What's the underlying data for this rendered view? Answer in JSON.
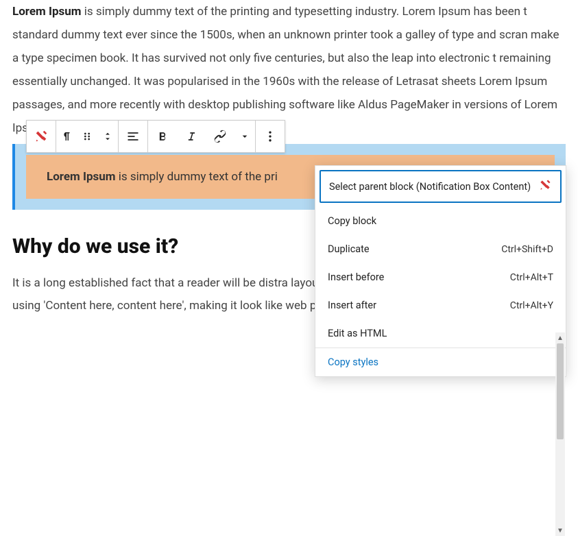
{
  "paragraph1": {
    "strong": "Lorem Ipsum",
    "text": " is simply dummy text of the printing and typesetting industry. Lorem Ipsum has been t standard dummy text ever since the 1500s, when an unknown printer took a galley of type and scran make a type specimen book. It has survived not only five centuries, but also the leap into electronic t remaining essentially unchanged. It was popularised in the 1960s with the release of Letrasat sheets Lorem Ipsum passages, and more recently with desktop publishing software like Aldus PageMaker in versions of Lorem Ipsum."
  },
  "callout": {
    "strong": "Lorem Ipsum",
    "text": " is simply dummy text of the pri"
  },
  "heading": "Why do we use it?",
  "paragraph2": "It is a long established fact that a reader will be distra layout. The point of using Lorem Ipsum is that it has using 'Content here, content here', making it look like web page editors now use Lorem Ipsum as their defa",
  "menu": {
    "parent": "Select parent block (Notification Box Content)",
    "copy": "Copy block",
    "duplicate": "Duplicate",
    "duplicate_kb": "Ctrl+Shift+D",
    "insert_before": "Insert before",
    "insert_before_kb": "Ctrl+Alt+T",
    "insert_after": "Insert after",
    "insert_after_kb": "Ctrl+Alt+Y",
    "edit_html": "Edit as HTML",
    "copy_styles": "Copy styles"
  }
}
